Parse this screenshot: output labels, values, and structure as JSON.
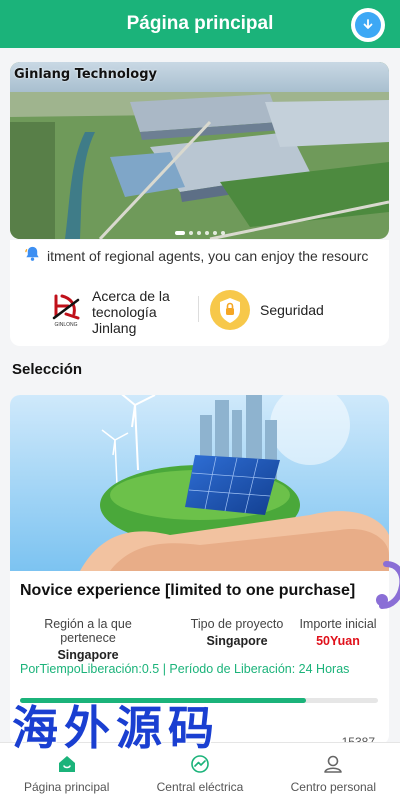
{
  "header": {
    "title": "Página principal",
    "download_icon": "download-icon"
  },
  "banner": {
    "label": "Ginlang Technology",
    "dots": 6
  },
  "notice": {
    "icon": "bell-icon",
    "text": "itment of regional agents, you can enjoy the resourc"
  },
  "shortcuts": [
    {
      "label": "Acerca de la tecnología Jinlang",
      "logo_text": "GINLONG",
      "icon": "company-logo"
    },
    {
      "label": "Seguridad",
      "icon": "shield-lock-icon"
    }
  ],
  "section": {
    "title": "Selección"
  },
  "product": {
    "name": "Novice experience [limited to one purchase]",
    "region_label": "Región a la que pertenece",
    "region_value": "Singapore",
    "type_label": "Tipo de proyecto",
    "type_value": "Singapore",
    "amount_label": "Importe inicial",
    "amount_value": "50Yuan",
    "release_text": "PorTiempoLiberación:0.5",
    "period_text": "Período de Liberación:  24 Horas",
    "progress": 0.8,
    "count_text": "15387"
  },
  "watermark": "海外源码",
  "tabs": [
    {
      "label": "Página principal",
      "icon": "home-icon"
    },
    {
      "label": "Central eléctrica",
      "icon": "power-station-icon"
    },
    {
      "label": "Centro personal",
      "icon": "user-icon"
    }
  ],
  "colors": {
    "brand": "#1bb37a",
    "price": "#e0101a",
    "watermark": "#1a3fd1"
  }
}
